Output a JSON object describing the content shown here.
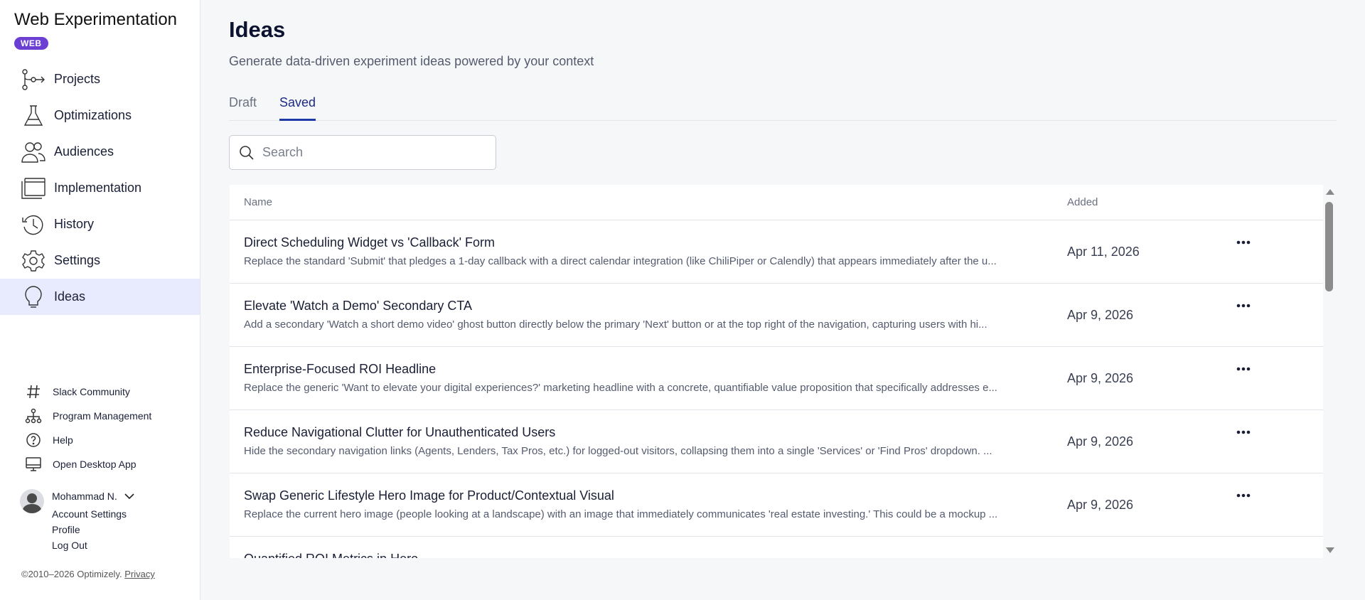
{
  "app": {
    "title": "Web Experimentation",
    "badge": "WEB"
  },
  "sidebar": {
    "items": [
      {
        "label": "Projects",
        "icon": "projects-icon"
      },
      {
        "label": "Optimizations",
        "icon": "flask-icon"
      },
      {
        "label": "Audiences",
        "icon": "people-icon"
      },
      {
        "label": "Implementation",
        "icon": "window-icon"
      },
      {
        "label": "History",
        "icon": "history-icon"
      },
      {
        "label": "Settings",
        "icon": "gear-icon"
      },
      {
        "label": "Ideas",
        "icon": "lightbulb-icon",
        "active": true
      }
    ],
    "links": [
      {
        "label": "Slack Community",
        "icon": "hash-icon"
      },
      {
        "label": "Program Management",
        "icon": "org-chart-icon"
      },
      {
        "label": "Help",
        "icon": "help-icon"
      },
      {
        "label": "Open Desktop App",
        "icon": "desktop-icon"
      }
    ],
    "user": {
      "name": "Mohammad N.",
      "links": [
        "Account Settings",
        "Profile",
        "Log Out"
      ]
    },
    "footer": {
      "copyright": "©2010–2026 Optimizely.",
      "privacy": "Privacy"
    }
  },
  "main": {
    "title": "Ideas",
    "subtitle": "Generate data-driven experiment ideas powered by your context",
    "tabs": [
      {
        "label": "Draft",
        "active": false
      },
      {
        "label": "Saved",
        "active": true
      }
    ],
    "search": {
      "placeholder": "Search",
      "value": ""
    },
    "table": {
      "columns": {
        "name": "Name",
        "added": "Added"
      },
      "rows": [
        {
          "title": "Direct Scheduling Widget vs 'Callback' Form",
          "description": "Replace the standard 'Submit' that pledges a 1-day callback with a direct calendar integration (like ChiliPiper or Calendly) that appears immediately after the u...",
          "added": "Apr 11, 2026"
        },
        {
          "title": "Elevate 'Watch a Demo' Secondary CTA",
          "description": "Add a secondary 'Watch a short demo video' ghost button directly below the primary 'Next' button or at the top right of the navigation, capturing users with hi...",
          "added": "Apr 9, 2026"
        },
        {
          "title": "Enterprise-Focused ROI Headline",
          "description": "Replace the generic 'Want to elevate your digital experiences?' marketing headline with a concrete, quantifiable value proposition that specifically addresses e...",
          "added": "Apr 9, 2026"
        },
        {
          "title": "Reduce Navigational Clutter for Unauthenticated Users",
          "description": "Hide the secondary navigation links (Agents, Lenders, Tax Pros, etc.) for logged-out visitors, collapsing them into a single 'Services' or 'Find Pros' dropdown. ...",
          "added": "Apr 9, 2026"
        },
        {
          "title": "Swap Generic Lifestyle Hero Image for Product/Contextual Visual",
          "description": "Replace the current hero image (people looking at a landscape) with an image that immediately communicates 'real estate investing.' This could be a mockup ...",
          "added": "Apr 9, 2026"
        },
        {
          "title": "Quantified ROI Metrics in Hero",
          "description": "",
          "added": ""
        }
      ]
    }
  },
  "colors": {
    "accent": "#1f3aa8",
    "badge": "#6b3fd4",
    "active_nav": "#e8ebfd"
  }
}
